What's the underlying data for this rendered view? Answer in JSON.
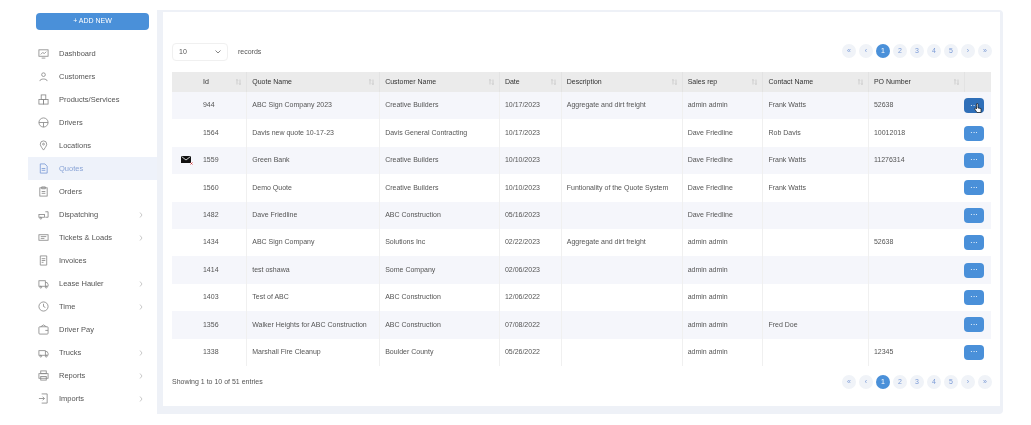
{
  "sidebar": {
    "add_button": "+ ADD NEW",
    "items": [
      {
        "label": "Dashboard",
        "selected": false,
        "has_submenu": false
      },
      {
        "label": "Customers",
        "selected": false,
        "has_submenu": false
      },
      {
        "label": "Products/Services",
        "selected": false,
        "has_submenu": false
      },
      {
        "label": "Drivers",
        "selected": false,
        "has_submenu": false
      },
      {
        "label": "Locations",
        "selected": false,
        "has_submenu": false
      },
      {
        "label": "Quotes",
        "selected": true,
        "has_submenu": false
      },
      {
        "label": "Orders",
        "selected": false,
        "has_submenu": false
      },
      {
        "label": "Dispatching",
        "selected": false,
        "has_submenu": true
      },
      {
        "label": "Tickets & Loads",
        "selected": false,
        "has_submenu": true
      },
      {
        "label": "Invoices",
        "selected": false,
        "has_submenu": false
      },
      {
        "label": "Lease Hauler",
        "selected": false,
        "has_submenu": true
      },
      {
        "label": "Time",
        "selected": false,
        "has_submenu": true
      },
      {
        "label": "Driver Pay",
        "selected": false,
        "has_submenu": false
      },
      {
        "label": "Trucks",
        "selected": false,
        "has_submenu": true
      },
      {
        "label": "Reports",
        "selected": false,
        "has_submenu": true
      },
      {
        "label": "Imports",
        "selected": false,
        "has_submenu": true
      }
    ]
  },
  "page_size": {
    "value": "10",
    "label": "records"
  },
  "pagination_top": [
    {
      "label": "«",
      "selected": false
    },
    {
      "label": "‹",
      "selected": false
    },
    {
      "label": "1",
      "selected": true
    },
    {
      "label": "2",
      "selected": false
    },
    {
      "label": "3",
      "selected": false
    },
    {
      "label": "4",
      "selected": false
    },
    {
      "label": "5",
      "selected": false
    },
    {
      "label": "›",
      "selected": false
    },
    {
      "label": "»",
      "selected": false
    }
  ],
  "pagination_bottom": [
    {
      "label": "«",
      "selected": false
    },
    {
      "label": "‹",
      "selected": false
    },
    {
      "label": "1",
      "selected": true
    },
    {
      "label": "2",
      "selected": false
    },
    {
      "label": "3",
      "selected": false
    },
    {
      "label": "4",
      "selected": false
    },
    {
      "label": "5",
      "selected": false
    },
    {
      "label": "›",
      "selected": false
    },
    {
      "label": "»",
      "selected": false
    }
  ],
  "table": {
    "columns": [
      "Id",
      "Quote Name",
      "Customer Name",
      "Date",
      "Description",
      "Sales rep",
      "Contact Name",
      "PO Number"
    ],
    "rows": [
      {
        "email_flag": false,
        "hovered": true,
        "cells": [
          "944",
          "ABC Sign Company 2023",
          "Creative Builders",
          "10/17/2023",
          "Aggregate and dirt freight",
          "admin admin",
          "Frank Watts",
          "52638"
        ],
        "action": "···"
      },
      {
        "email_flag": false,
        "hovered": false,
        "cells": [
          "1564",
          "Davis new quote 10-17-23",
          "Davis General Contracting",
          "10/17/2023",
          "",
          "Dave Friedline",
          "Rob Davis",
          "10012018"
        ],
        "action": "···"
      },
      {
        "email_flag": true,
        "hovered": false,
        "cells": [
          "1559",
          "Green Bank",
          "Creative Builders",
          "10/10/2023",
          "",
          "Dave Friedline",
          "Frank Watts",
          "11276314"
        ],
        "action": "···"
      },
      {
        "email_flag": false,
        "hovered": false,
        "cells": [
          "1560",
          "Demo Quote",
          "Creative Builders",
          "10/10/2023",
          "Funtionality of the Quote System",
          "Dave Friedline",
          "Frank Watts",
          ""
        ],
        "action": "···"
      },
      {
        "email_flag": false,
        "hovered": false,
        "cells": [
          "1482",
          "Dave Friedline",
          "ABC Construction",
          "05/16/2023",
          "",
          "Dave Friedline",
          "",
          ""
        ],
        "action": "···"
      },
      {
        "email_flag": false,
        "hovered": false,
        "cells": [
          "1434",
          "ABC Sign Company",
          "Solutions Inc",
          "02/22/2023",
          "Aggregate and dirt freight",
          "admin admin",
          "",
          "52638"
        ],
        "action": "···"
      },
      {
        "email_flag": false,
        "hovered": false,
        "cells": [
          "1414",
          "test oshawa",
          "Some Company",
          "02/06/2023",
          "",
          "admin admin",
          "",
          ""
        ],
        "action": "···"
      },
      {
        "email_flag": false,
        "hovered": false,
        "cells": [
          "1403",
          "Test of ABC",
          "ABC Construction",
          "12/06/2022",
          "",
          "admin admin",
          "",
          ""
        ],
        "action": "···"
      },
      {
        "email_flag": false,
        "hovered": false,
        "cells": [
          "1356",
          "Walker Heights for ABC Construction",
          "ABC Construction",
          "07/08/2022",
          "",
          "admin admin",
          "Fred Doe",
          ""
        ],
        "action": "···"
      },
      {
        "email_flag": false,
        "hovered": false,
        "cells": [
          "1338",
          "Marshall Fire Cleanup",
          "Boulder County",
          "05/26/2022",
          "",
          "admin admin",
          "",
          "12345"
        ],
        "action": "···"
      }
    ]
  },
  "footer": {
    "summary": "Showing 1 to 10 of 51 entries"
  }
}
